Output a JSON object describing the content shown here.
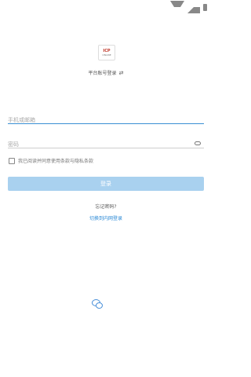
{
  "app": {
    "logo_line1": "ICP",
    "logo_line2": "ONLINE"
  },
  "header": {
    "platform_label": "平台账号登录",
    "swap_icon": "swap-icon"
  },
  "form": {
    "account_placeholder": "手机或邮箱",
    "password_placeholder": "密码",
    "agreement_text": "我已阅读并同意使用条款与隐私条款"
  },
  "actions": {
    "login_label": "登录",
    "forgot_label": "忘记密码?",
    "switch_label": "切换到内网登录"
  },
  "colors": {
    "accent": "#3a8fd4",
    "button_bg": "#a9d1ef",
    "link": "#2d8ad6"
  },
  "icons": {
    "wechat": "wechat-icon",
    "eye": "eye-icon"
  }
}
